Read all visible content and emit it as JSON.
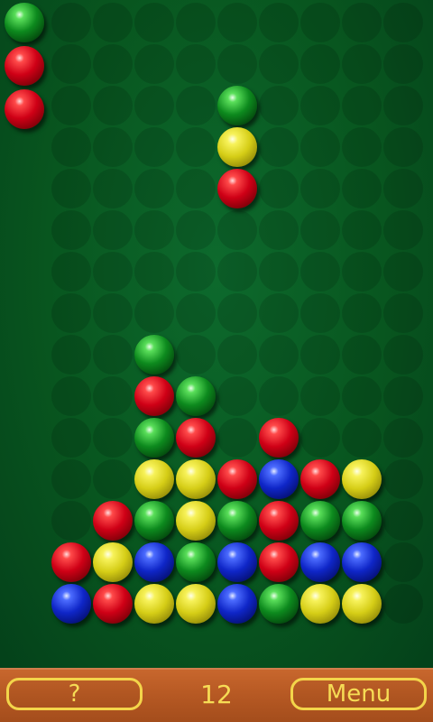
{
  "game": {
    "columns": 9,
    "rows": 15,
    "colors": {
      "red": "#cf0016",
      "green": "#0d8a1e",
      "yellow": "#d5cd16",
      "blue": "#0f26c8",
      "felt": "#08561f",
      "wood": "#b85a24",
      "accent": "#f6dc55"
    },
    "next_queue": [
      "green",
      "red",
      "red"
    ],
    "falling_piece": {
      "column": 5,
      "top_row": 3,
      "balls": [
        "green",
        "yellow",
        "red"
      ]
    },
    "stack": [
      {
        "col": 3,
        "row": 9,
        "color": "green"
      },
      {
        "col": 3,
        "row": 10,
        "color": "red"
      },
      {
        "col": 4,
        "row": 10,
        "color": "green"
      },
      {
        "col": 3,
        "row": 11,
        "color": "green"
      },
      {
        "col": 4,
        "row": 11,
        "color": "red"
      },
      {
        "col": 6,
        "row": 11,
        "color": "red"
      },
      {
        "col": 3,
        "row": 12,
        "color": "yellow"
      },
      {
        "col": 4,
        "row": 12,
        "color": "yellow"
      },
      {
        "col": 5,
        "row": 12,
        "color": "red"
      },
      {
        "col": 6,
        "row": 12,
        "color": "blue"
      },
      {
        "col": 7,
        "row": 12,
        "color": "red"
      },
      {
        "col": 8,
        "row": 12,
        "color": "yellow"
      },
      {
        "col": 2,
        "row": 13,
        "color": "red"
      },
      {
        "col": 3,
        "row": 13,
        "color": "green"
      },
      {
        "col": 4,
        "row": 13,
        "color": "yellow"
      },
      {
        "col": 5,
        "row": 13,
        "color": "green"
      },
      {
        "col": 6,
        "row": 13,
        "color": "red"
      },
      {
        "col": 7,
        "row": 13,
        "color": "green"
      },
      {
        "col": 8,
        "row": 13,
        "color": "green"
      },
      {
        "col": 1,
        "row": 14,
        "color": "red"
      },
      {
        "col": 2,
        "row": 14,
        "color": "yellow"
      },
      {
        "col": 3,
        "row": 14,
        "color": "blue"
      },
      {
        "col": 4,
        "row": 14,
        "color": "green"
      },
      {
        "col": 5,
        "row": 14,
        "color": "blue"
      },
      {
        "col": 6,
        "row": 14,
        "color": "red"
      },
      {
        "col": 7,
        "row": 14,
        "color": "blue"
      },
      {
        "col": 8,
        "row": 14,
        "color": "blue"
      },
      {
        "col": 1,
        "row": 15,
        "color": "blue"
      },
      {
        "col": 2,
        "row": 15,
        "color": "red"
      },
      {
        "col": 3,
        "row": 15,
        "color": "yellow"
      },
      {
        "col": 4,
        "row": 15,
        "color": "yellow"
      },
      {
        "col": 5,
        "row": 15,
        "color": "blue"
      },
      {
        "col": 6,
        "row": 15,
        "color": "green"
      },
      {
        "col": 7,
        "row": 15,
        "color": "yellow"
      },
      {
        "col": 8,
        "row": 15,
        "color": "yellow"
      }
    ]
  },
  "footer": {
    "help_label": "?",
    "score": "12",
    "menu_label": "Menu"
  }
}
